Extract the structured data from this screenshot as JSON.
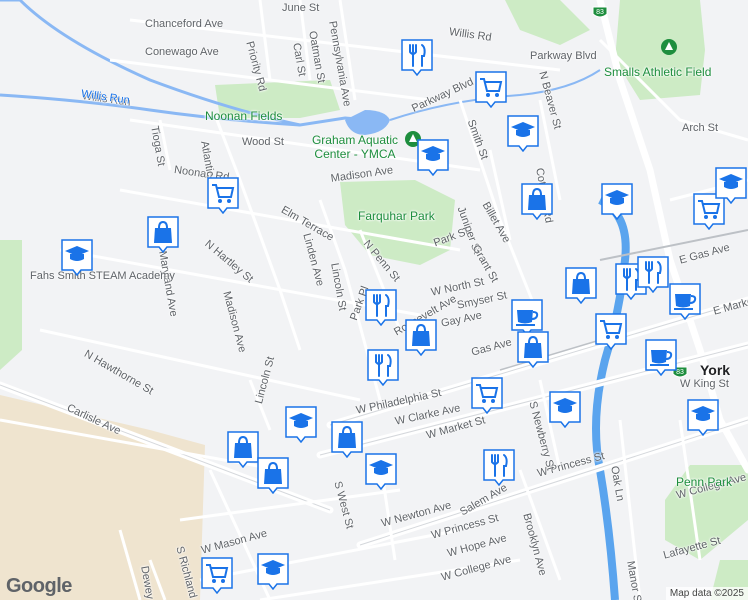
{
  "map": {
    "city_label": "York",
    "attribution": "Map data ©2025",
    "logo_text": "Google",
    "colors": {
      "land": "#f2f3f5",
      "park": "#cdebc5",
      "water": "#8ab8f4",
      "road": "#ffffff",
      "road_stroke": "#d5d8dc",
      "marker": "#1a73e8",
      "marker_bg": "#ffffff",
      "sand": "#efe4cf"
    },
    "streets": [
      "June St",
      "Willis Rd",
      "Parkway Blvd",
      "Chanceford Ave",
      "Conewago Ave",
      "Priority Rd",
      "Carl St",
      "Oatman St",
      "Pennsylvania Ave",
      "Parkway Blvd",
      "Willis Run",
      "Noonan Fields",
      "Wood St",
      "Noonan Rd",
      "Tioga St",
      "Atlantic Ave",
      "Madison Ave",
      "Elm Terrace",
      "Linden Ave",
      "N Penn St",
      "Park St",
      "Billet Ave",
      "Juniper St",
      "Grant St",
      "Smith St",
      "N Beaver St",
      "Arch St",
      "N Hartley St",
      "Maryland Ave",
      "Madison Ave",
      "Lincoln St",
      "W North St",
      "Smyser St",
      "Gay Ave",
      "N Hawthorne St",
      "Carlisle Ave",
      "Lincoln St",
      "W Philadelphia St",
      "W Clarke Ave",
      "W Market St",
      "S West St",
      "W Newton Ave",
      "Salem Ave",
      "W Princess St",
      "W Princess St",
      "W Hope Ave",
      "W College Ave",
      "W Mason Ave",
      "Dewey St",
      "S Richland Ave",
      "Brooklyn Ave",
      "S Newberry St",
      "Oak Ln",
      "W King St",
      "W College Ave",
      "Lafayette St",
      "Manor St",
      "Penn Park",
      "E Gas Ave",
      "E Market St",
      "Park Pl",
      "Roosevelt Ave",
      "Fahs Smith STEAM Academy",
      "Cottage Rd",
      "Gas Ave"
    ],
    "places": [
      {
        "name": "Smalls Athletic Field",
        "kind": "park"
      },
      {
        "name": "Graham Aquatic Center - YMCA",
        "kind": "park"
      },
      {
        "name": "Farquhar Park",
        "kind": "park"
      },
      {
        "name": "Noonan Fields",
        "kind": "park"
      },
      {
        "name": "Penn Park",
        "kind": "park"
      }
    ],
    "route_shields": [
      "83",
      "83"
    ],
    "markers": [
      {
        "icon": "restaurant-icon"
      },
      {
        "icon": "shopping-cart-icon"
      },
      {
        "icon": "school-icon"
      },
      {
        "icon": "school-icon"
      },
      {
        "icon": "shopping-bag-icon"
      },
      {
        "icon": "school-icon"
      },
      {
        "icon": "shopping-cart-icon"
      },
      {
        "icon": "shopping-cart-icon"
      },
      {
        "icon": "shopping-bag-icon"
      },
      {
        "icon": "school-icon"
      },
      {
        "icon": "shopping-bag-icon"
      },
      {
        "icon": "restaurant-icon"
      },
      {
        "icon": "shopping-bag-icon"
      },
      {
        "icon": "restaurant-icon"
      },
      {
        "icon": "coffee-icon"
      },
      {
        "icon": "shopping-bag-icon"
      },
      {
        "icon": "shopping-cart-icon"
      },
      {
        "icon": "restaurant-icon"
      },
      {
        "icon": "coffee-icon"
      },
      {
        "icon": "coffee-icon"
      },
      {
        "icon": "restaurant-icon"
      },
      {
        "icon": "shopping-cart-icon"
      },
      {
        "icon": "school-icon"
      },
      {
        "icon": "school-icon"
      },
      {
        "icon": "shopping-bag-icon"
      },
      {
        "icon": "school-icon"
      },
      {
        "icon": "shopping-bag-icon"
      },
      {
        "icon": "shopping-bag-icon"
      },
      {
        "icon": "school-icon"
      },
      {
        "icon": "restaurant-icon"
      },
      {
        "icon": "shopping-cart-icon"
      },
      {
        "icon": "school-icon"
      },
      {
        "icon": "school-icon"
      }
    ]
  }
}
